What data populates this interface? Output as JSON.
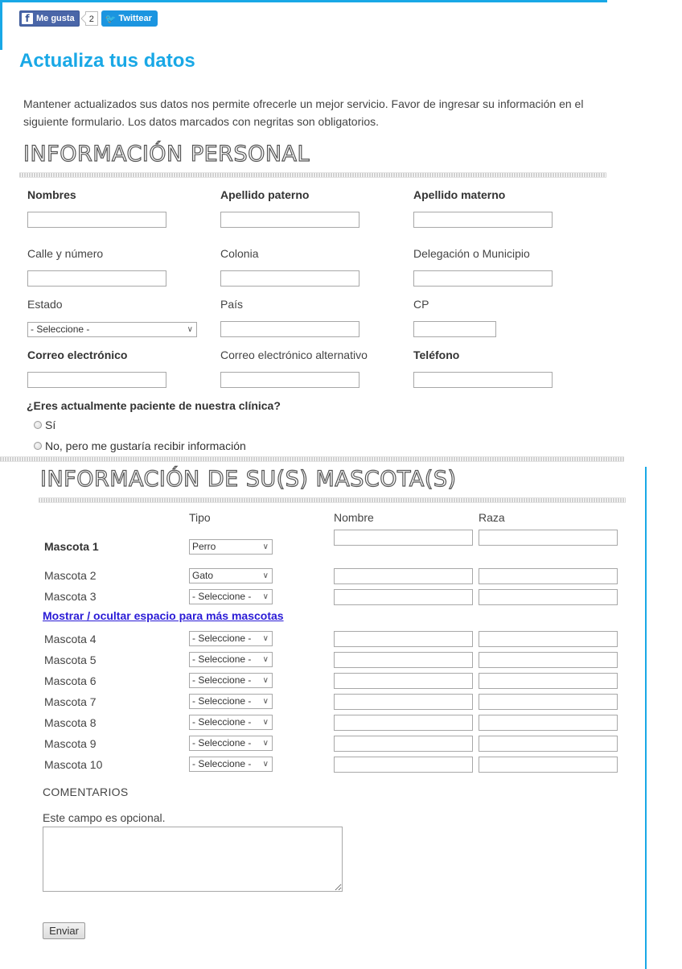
{
  "social": {
    "like_label": "Me gusta",
    "like_count": "2",
    "tweet_label": "Twittear"
  },
  "page_title": "Actualiza tus datos",
  "intro_text": "Mantener actualizados sus datos nos permite ofrecerle un mejor servicio. Favor de ingresar su información en el siguiente formulario. Los datos marcados con negritas son obligatorios.",
  "personal": {
    "title": "INFORMACIÓN PERSONAL",
    "nombres": "Nombres",
    "apellido_paterno": "Apellido paterno",
    "apellido_materno": "Apellido materno",
    "calle": "Calle y número",
    "colonia": "Colonia",
    "delegacion": "Delegación o Municipio",
    "estado": "Estado",
    "estado_value": "- Seleccione -",
    "pais": "País",
    "cp": "CP",
    "correo": "Correo electrónico",
    "correo_alt": "Correo electrónico alternativo",
    "telefono": "Teléfono",
    "paciente_question": "¿Eres actualmente paciente de nuestra clínica?",
    "radio_si": "Sí",
    "radio_no": "No, pero me gustaría recibir información"
  },
  "pets": {
    "title": "INFORMACIÓN DE SU(S) MASCOTA(S)",
    "col_tipo": "Tipo",
    "col_nombre": "Nombre",
    "col_raza": "Raza",
    "toggle_link": "Mostrar / ocultar espacio para más mascotas",
    "rows": [
      {
        "label": "Mascota 1",
        "tipo": "Perro"
      },
      {
        "label": "Mascota 2",
        "tipo": "Gato"
      },
      {
        "label": "Mascota 3",
        "tipo": "- Seleccione -"
      },
      {
        "label": "Mascota 4",
        "tipo": "- Seleccione -"
      },
      {
        "label": "Mascota 5",
        "tipo": "- Seleccione -"
      },
      {
        "label": "Mascota 6",
        "tipo": "- Seleccione -"
      },
      {
        "label": "Mascota 7",
        "tipo": "- Seleccione -"
      },
      {
        "label": "Mascota 8",
        "tipo": "- Seleccione -"
      },
      {
        "label": "Mascota 9",
        "tipo": "- Seleccione -"
      },
      {
        "label": "Mascota 10",
        "tipo": "- Seleccione -"
      }
    ]
  },
  "comments": {
    "title": "COMENTARIOS",
    "hint": "Este campo es opcional."
  },
  "submit_label": "Enviar"
}
